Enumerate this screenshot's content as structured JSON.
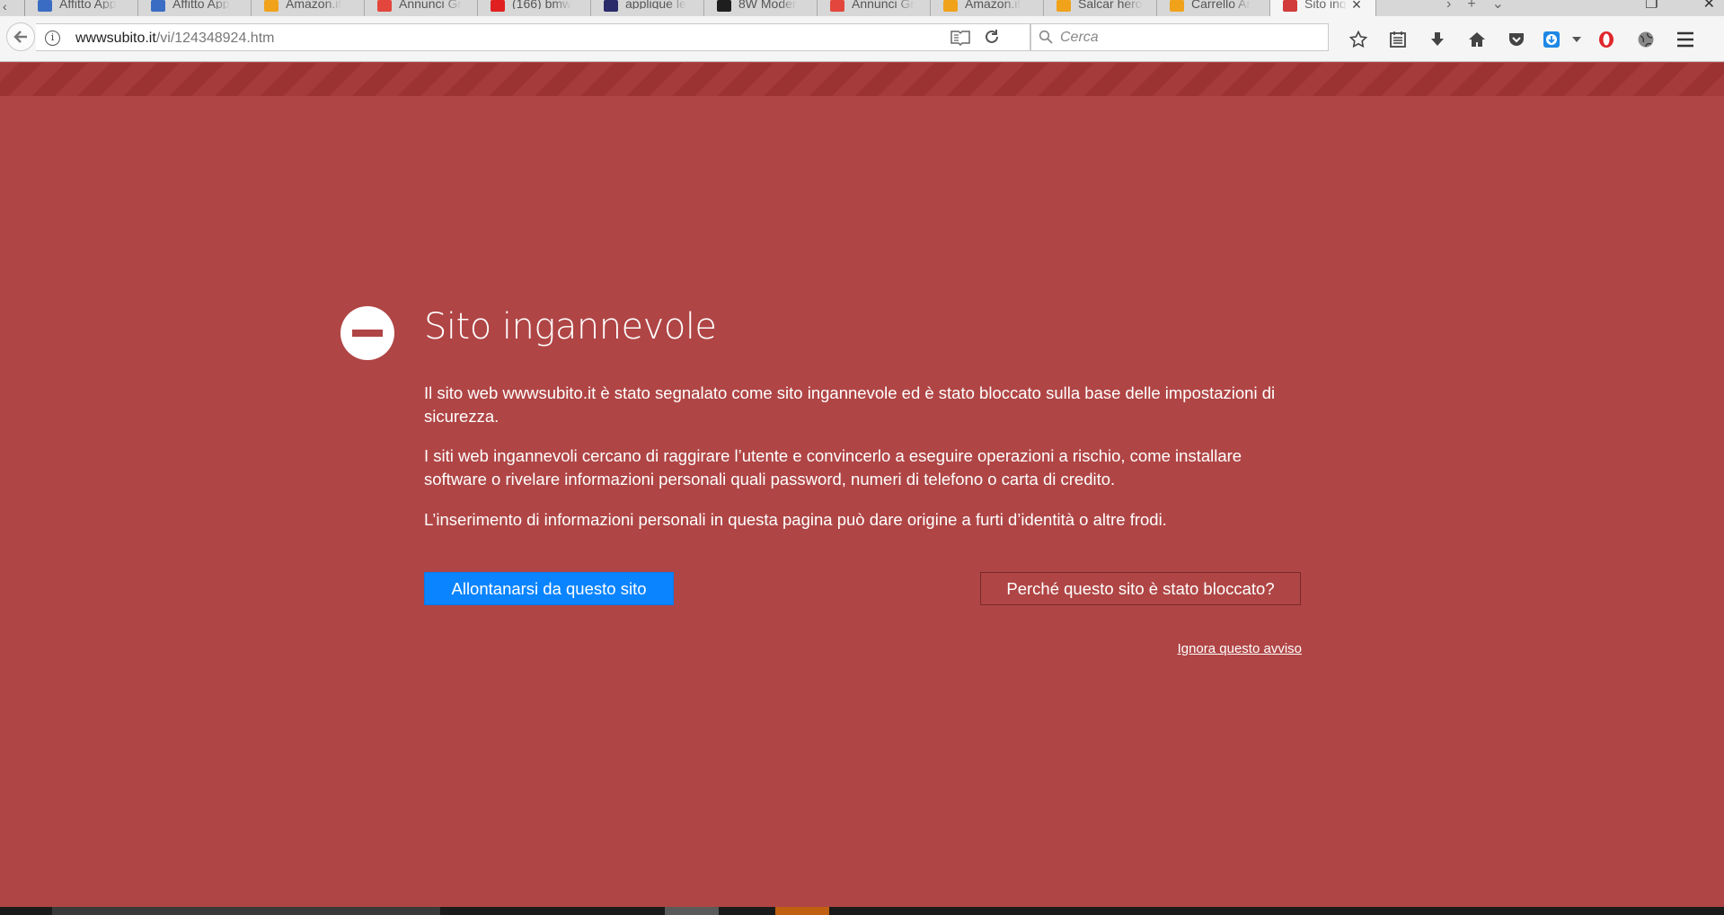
{
  "browser": {
    "tabs": [
      {
        "label": "Affitto App",
        "favicon_color": "#3b6cc4",
        "active": false
      },
      {
        "label": "Affitto App",
        "favicon_color": "#3b6cc4",
        "active": false
      },
      {
        "label": "Amazon.it",
        "favicon_color": "#f0a21b",
        "active": false
      },
      {
        "label": "Annunci Gr",
        "favicon_color": "#e3463c",
        "active": false
      },
      {
        "label": "(166) bmw",
        "favicon_color": "#e02020",
        "active": false
      },
      {
        "label": "applique le",
        "favicon_color": "#2a2a6a",
        "active": false
      },
      {
        "label": "8W Moder",
        "favicon_color": "#1e1e1e",
        "active": false
      },
      {
        "label": "Annunci Gr",
        "favicon_color": "#e3463c",
        "active": false
      },
      {
        "label": "Amazon.it",
        "favicon_color": "#f0a21b",
        "active": false
      },
      {
        "label": "Salcar hero",
        "favicon_color": "#f0a21b",
        "active": false
      },
      {
        "label": "Carrello Ar",
        "favicon_color": "#f0a21b",
        "active": false
      },
      {
        "label": "Sito ing",
        "favicon_color": "#d23b3b",
        "active": true
      }
    ],
    "url": {
      "domain": "wwwsubito.it",
      "path": "/vi/124348924.htm"
    },
    "search": {
      "placeholder": "Cerca"
    },
    "toolbar_icons": [
      "bookmark-star-icon",
      "reading-list-icon",
      "download-icon",
      "home-icon",
      "pocket-icon",
      "extension-download-icon",
      "dropdown-icon",
      "opera-icon",
      "globe-icon",
      "menu-icon"
    ]
  },
  "page": {
    "title": "Sito ingannevole",
    "paragraphs": [
      "Il sito web wwwsubito.it è stato segnalato come sito ingannevole ed è stato bloccato sulla base delle impostazioni di sicurezza.",
      "I siti web ingannevoli cercano di raggirare l’utente e convincerlo a eseguire operazioni a rischio, come installare software o rivelare informazioni personali quali password, numeri di telefono o carta di credito.",
      "L’inserimento di informazioni personali in questa pagina può dare origine a furti d’identità o altre frodi."
    ],
    "primary_button": "Allontanarsi da questo sito",
    "secondary_button": "Perché questo sito è stato bloccato?",
    "ignore_link": "Ignora questo avviso",
    "colors": {
      "background": "#b04545",
      "primary": "#0a84ff"
    }
  }
}
